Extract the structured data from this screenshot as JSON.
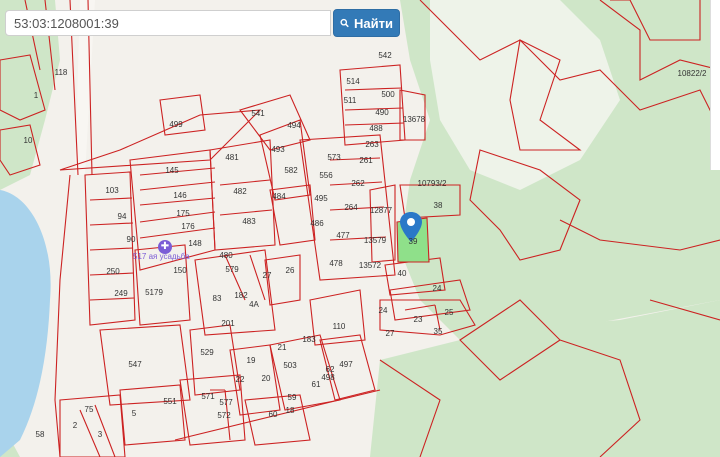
{
  "search": {
    "value": "53:03:1208001:39",
    "button_label": "Найти"
  },
  "poi": {
    "label": "517 ая усадьба",
    "icon": "cross-icon"
  },
  "colors": {
    "parcel_border": "#cc2222",
    "forest": "#cfe6c8",
    "water": "#a9d3ec",
    "selected": "#8fe08a",
    "marker": "#2a78c8",
    "button": "#337ab7"
  },
  "parcels": [
    "514",
    "500",
    "542",
    "511",
    "490",
    "488",
    "263",
    "13678",
    "573",
    "261",
    "556",
    "262",
    "495",
    "264",
    "12877",
    "477",
    "13579",
    "486",
    "478",
    "13572",
    "40",
    "24",
    "38",
    "10793/2",
    "39",
    "499",
    "541",
    "494",
    "493",
    "481",
    "482",
    "582",
    "484",
    "483",
    "145",
    "146",
    "175",
    "176",
    "148",
    "103",
    "94",
    "90",
    "480",
    "579",
    "250",
    "249",
    "5179",
    "150",
    "27",
    "26",
    "83",
    "182",
    "4А",
    "201",
    "110",
    "24",
    "25",
    "23",
    "35",
    "27",
    "529",
    "19",
    "21",
    "183",
    "547",
    "22",
    "20",
    "503",
    "61",
    "62",
    "497",
    "498",
    "551",
    "571",
    "577",
    "572",
    "75",
    "5",
    "3",
    "2",
    "18",
    "59",
    "60",
    "58",
    "1",
    "10",
    "118",
    "10822/2",
    "10793/2"
  ]
}
